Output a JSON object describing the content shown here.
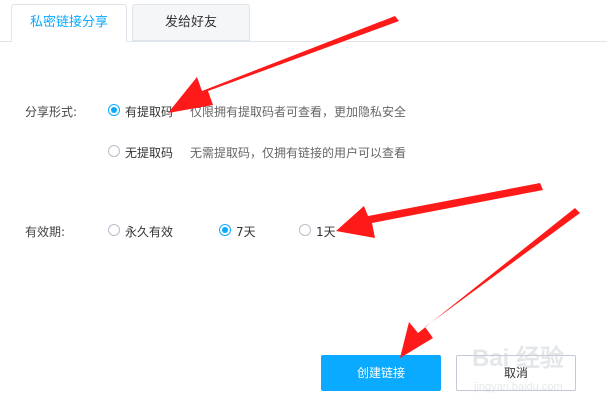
{
  "tabs": {
    "private_link": "私密链接分享",
    "send_friend": "发给好友"
  },
  "share_form": {
    "label": "分享形式:",
    "options": [
      {
        "label": "有提取码",
        "desc": "仅限拥有提取码者可查看，更加隐私安全",
        "checked": true
      },
      {
        "label": "无提取码",
        "desc": "无需提取码，仅拥有链接的用户可以查看",
        "checked": false
      }
    ]
  },
  "validity": {
    "label": "有效期:",
    "options": [
      {
        "label": "永久有效",
        "checked": false
      },
      {
        "label": "7天",
        "checked": true
      },
      {
        "label": "1天",
        "checked": false
      }
    ]
  },
  "buttons": {
    "create": "创建链接",
    "cancel": "取消"
  },
  "watermark": {
    "text": "Bai 经验",
    "sub": "jingyan.baidu.com"
  },
  "colors": {
    "accent": "#09aaff",
    "arrow": "#ff1a1a"
  }
}
